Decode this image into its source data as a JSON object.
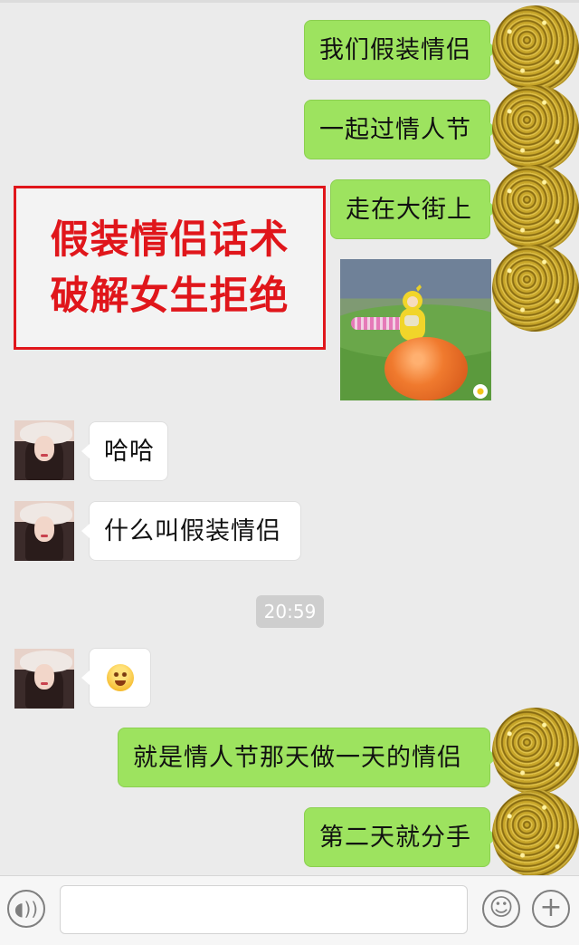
{
  "promo": {
    "line1": "假装情侣话术",
    "line2": "破解女生拒绝"
  },
  "messages": [
    {
      "side": "me",
      "type": "text",
      "text": "我们假装情侣"
    },
    {
      "side": "me",
      "type": "text",
      "text": "一起过情人节"
    },
    {
      "side": "me",
      "type": "text",
      "text": "走在大街上"
    },
    {
      "side": "me",
      "type": "image",
      "icon": "teletubby-photo"
    },
    {
      "side": "them",
      "type": "text",
      "text": "哈哈"
    },
    {
      "side": "them",
      "type": "text",
      "text": "什么叫假装情侣"
    },
    {
      "side": "system",
      "type": "timestamp",
      "text": "20:59"
    },
    {
      "side": "them",
      "type": "emoji",
      "icon": "smirk-emoji"
    },
    {
      "side": "me",
      "type": "text",
      "text": "就是情人节那天做一天的情侣"
    },
    {
      "side": "me",
      "type": "text",
      "text": "第二天就分手"
    }
  ],
  "input_bar": {
    "voice_icon": "voice-icon",
    "text_value": "",
    "emoji_icon": "emoji-icon",
    "plus_icon": "plus-icon"
  },
  "colors": {
    "my_bubble": "#9de35f",
    "their_bubble": "#ffffff",
    "background": "#ebebeb",
    "promo_red": "#e0161b"
  }
}
